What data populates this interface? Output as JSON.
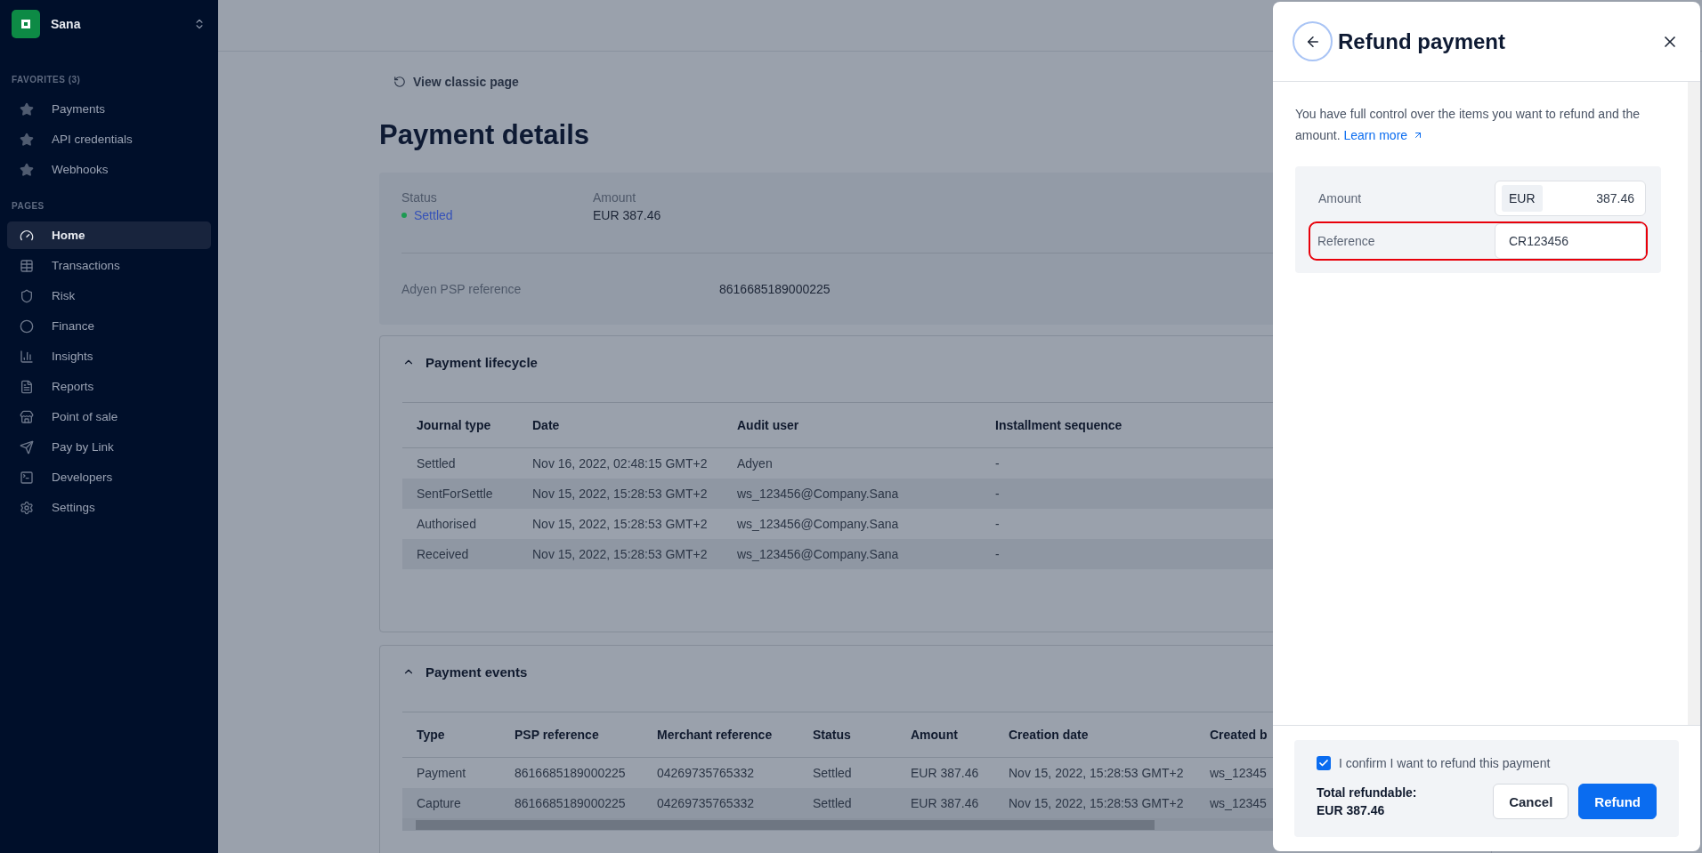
{
  "sidebar": {
    "account": "Sana",
    "sections": [
      {
        "title": "FAVORITES (3)",
        "kind": "favorites",
        "items": [
          {
            "label": "Payments",
            "selected": false
          },
          {
            "label": "API credentials",
            "selected": false
          },
          {
            "label": "Webhooks",
            "selected": false
          }
        ]
      },
      {
        "title": "PAGES",
        "kind": "pages",
        "items": [
          {
            "label": "Home",
            "selected": true
          },
          {
            "label": "Transactions",
            "selected": false
          },
          {
            "label": "Risk",
            "selected": false
          },
          {
            "label": "Finance",
            "selected": false
          },
          {
            "label": "Insights",
            "selected": false
          },
          {
            "label": "Reports",
            "selected": false
          },
          {
            "label": "Point of sale",
            "selected": false
          },
          {
            "label": "Pay by Link",
            "selected": false
          },
          {
            "label": "Developers",
            "selected": false
          },
          {
            "label": "Settings",
            "selected": false
          }
        ]
      }
    ]
  },
  "page": {
    "back_link": "View classic page",
    "title": "Payment details",
    "summary": {
      "status_label": "Status",
      "status": "Settled",
      "amount_label": "Amount",
      "amount": "EUR 387.46",
      "psp_label": "Adyen PSP reference",
      "psp": "8616685189000225"
    },
    "lifecycle": {
      "title": "Payment lifecycle",
      "expanded": true,
      "columns": [
        "Journal type",
        "Date",
        "Audit user",
        "Installment sequence"
      ],
      "rows": [
        [
          "Settled",
          "Nov 16, 2022, 02:48:15 GMT+2",
          "Adyen",
          "-"
        ],
        [
          "SentForSettle",
          "Nov 15, 2022, 15:28:53 GMT+2",
          "ws_123456@Company.Sana",
          "-"
        ],
        [
          "Authorised",
          "Nov 15, 2022, 15:28:53 GMT+2",
          "ws_123456@Company.Sana",
          "-"
        ],
        [
          "Received",
          "Nov 15, 2022, 15:28:53 GMT+2",
          "ws_123456@Company.Sana",
          "-"
        ]
      ]
    },
    "events": {
      "title": "Payment events",
      "expanded": true,
      "columns": [
        "Type",
        "PSP reference",
        "Merchant reference",
        "Status",
        "Amount",
        "Creation date",
        "Created b"
      ],
      "rows": [
        [
          "Payment",
          "8616685189000225",
          "04269735765332",
          "Settled",
          "EUR 387.46",
          "Nov 15, 2022, 15:28:53 GMT+2",
          "ws_12345"
        ],
        [
          "Capture",
          "8616685189000225",
          "04269735765332",
          "Settled",
          "EUR 387.46",
          "Nov 15, 2022, 15:28:53 GMT+2",
          "ws_12345"
        ]
      ]
    }
  },
  "drawer": {
    "title": "Refund payment",
    "intro": "You have full control over the items you want to refund and the amount.",
    "link": "Learn more",
    "fields": [
      {
        "label": "Amount",
        "kind": "currency",
        "currency": "EUR",
        "value": "387.46",
        "highlighted": false
      },
      {
        "label": "Reference",
        "kind": "text",
        "value": "CR123456",
        "highlighted": true
      }
    ],
    "confirm": {
      "label": "I confirm I want to refund this payment",
      "checked": true
    },
    "total_label": "Total refundable:",
    "total": "EUR 387.46",
    "buttons": [
      {
        "label": "Cancel",
        "kind": "secondary"
      },
      {
        "label": "Refund",
        "kind": "primary"
      }
    ]
  }
}
